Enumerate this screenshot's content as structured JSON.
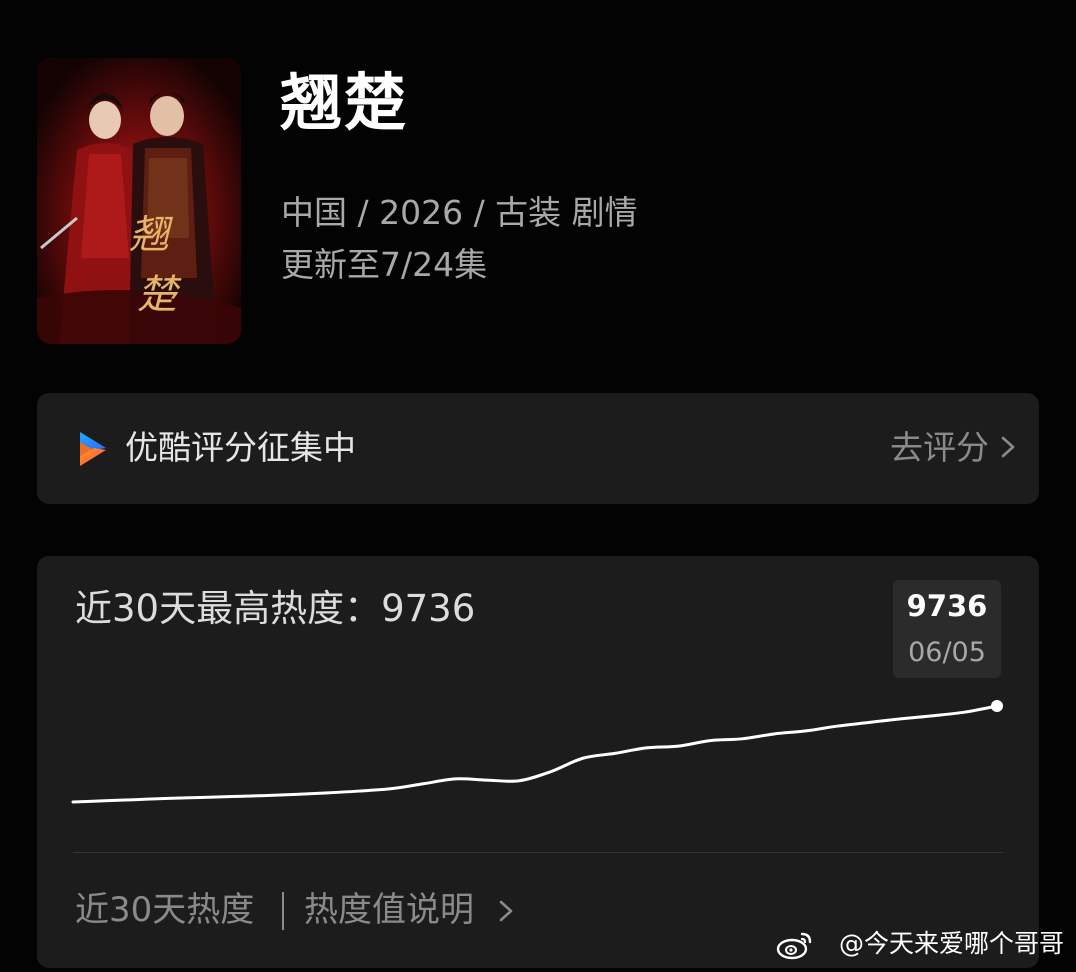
{
  "show": {
    "title": "翘楚",
    "meta": "中国 / 2026 / 古装 剧情",
    "update": "更新至7/24集"
  },
  "poster": {
    "calligraphy_char_1": "翘",
    "calligraphy_char_2": "楚",
    "dominant_color": "#a61414"
  },
  "rating": {
    "logo_icon": "youku-logo-icon",
    "label": "优酷评分征集中",
    "action": "去评分",
    "action_icon": "chevron-right-icon"
  },
  "heat": {
    "label": "近30天最高热度：9736",
    "tooltip_value": "9736",
    "tooltip_date": "06/05",
    "footer_left": "近30天热度",
    "footer_right": "热度值说明",
    "footer_icon": "chevron-right-icon"
  },
  "chart_data": {
    "type": "line",
    "title": "",
    "xlabel": "",
    "ylabel": "",
    "ylim": [
      0,
      9736
    ],
    "grid": false,
    "line_color": "#ffffff",
    "series": [
      {
        "values": [
          6700,
          6720,
          6740,
          6760,
          6775,
          6790,
          6805,
          6825,
          6850,
          6880,
          6920,
          7000,
          7080,
          7060,
          7050,
          7200,
          7420,
          7500,
          7590,
          7620,
          7710,
          7740,
          7820,
          7870,
          7950,
          8010,
          8070,
          8120,
          8180,
          8280
        ],
        "highlight_last": true
      }
    ]
  },
  "watermark": {
    "icon": "weibo-icon",
    "text": "@今天来爱哪个哥哥"
  }
}
